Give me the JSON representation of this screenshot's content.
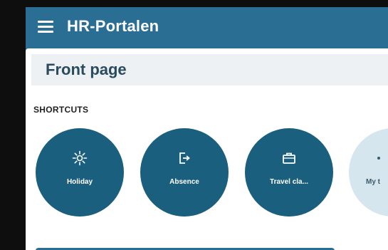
{
  "header": {
    "title": "HR-Portalen",
    "menu_icon": "hamburger-menu-icon"
  },
  "page": {
    "title": "Front page"
  },
  "shortcuts": {
    "section_label": "SHORTCUTS",
    "items": [
      {
        "label": "Holiday",
        "icon": "sun-icon"
      },
      {
        "label": "Absence",
        "icon": "exit-door-icon"
      },
      {
        "label": "Travel cla...",
        "icon": "briefcase-icon"
      },
      {
        "label": "My t",
        "icon": "partial-icon"
      }
    ]
  },
  "colors": {
    "header_bg": "#2a6f93",
    "shortcut_bg": "#1b5f7e",
    "shortcut_light_bg": "#d5e6ef",
    "page_title_color": "#2a4a5e"
  }
}
